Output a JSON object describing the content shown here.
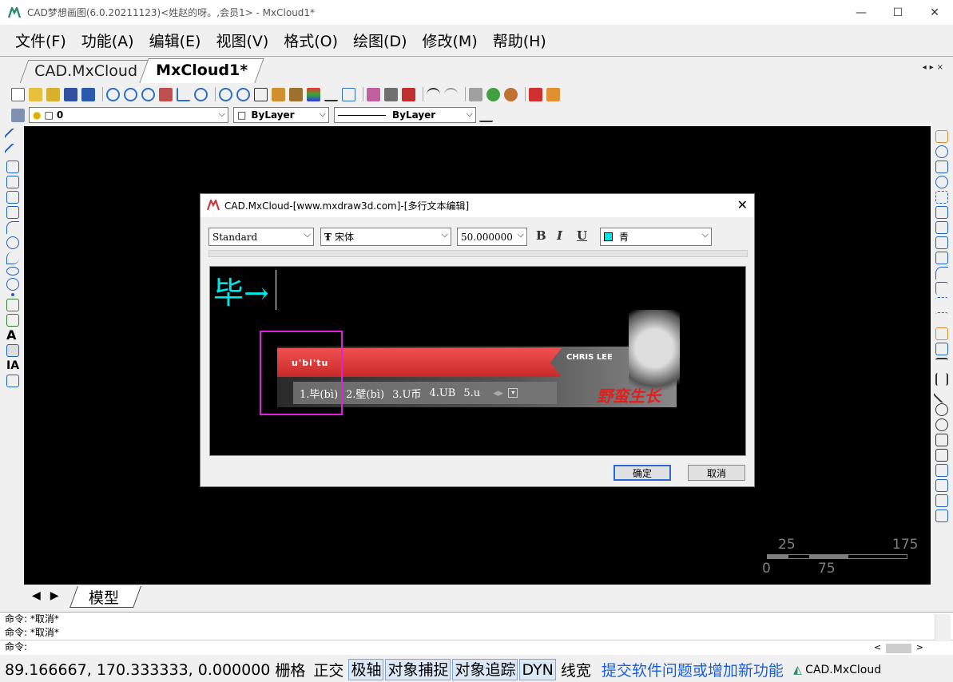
{
  "window": {
    "title": "CAD梦想画图(6.0.20211123)<姓赵的呀。,会员1> - MxCloud1*",
    "min": "—",
    "max": "☐",
    "close": "✕"
  },
  "menu": [
    "文件(F)",
    "功能(A)",
    "编辑(E)",
    "视图(V)",
    "格式(O)",
    "绘图(D)",
    "修改(M)",
    "帮助(H)"
  ],
  "tabs": [
    "CAD.MxCloud",
    "MxCloud1*"
  ],
  "tabnav": "◂▸×",
  "layer": {
    "value": "0",
    "color": "ByLayer",
    "linetype": "ByLayer"
  },
  "scalebar": {
    "top_left": "25",
    "top_right": "175",
    "bottom_left": "0",
    "bottom_mid": "75"
  },
  "model_tab": "模型",
  "bottom_nav": "◀▶",
  "commands": [
    "命令:   *取消*",
    "命令:   *取消*",
    "命令:"
  ],
  "cmdscroll": {
    "left": "<",
    "right": ">"
  },
  "status": {
    "coords": "89.166667,  170.333333,  0.000000",
    "grid": "栅格",
    "ortho": "正交",
    "polar": "极轴",
    "osnap": "对象捕捉",
    "otrack": "对象追踪",
    "dyn": "DYN",
    "lw": "线宽",
    "feedback": "提交软件问题或增加新功能",
    "brand": "CAD.MxCloud"
  },
  "dialog": {
    "title": "CAD.MxCloud-[www.mxdraw3d.com]-[多行文本编辑]",
    "close": "✕",
    "style": "Standard",
    "font": "宋体",
    "size": "50.000000",
    "bold": "B",
    "italic": "I",
    "underline": "U",
    "color": "青",
    "editor_text": "毕→",
    "ime": {
      "input": "u'bi'tu",
      "candidates": [
        "1.毕(bì)",
        "2.壁(bì)",
        "3.U币",
        "4.UB",
        "5.u"
      ],
      "skin": "CHRIS LEE",
      "skin_text": "野蛮生长"
    },
    "ok": "确定",
    "cancel": "取消"
  },
  "colors": {
    "cyan": "#00e5e5",
    "magenta": "#e020e0",
    "status_link": "#1a5fd8",
    "ime_red": "#e0383a"
  }
}
